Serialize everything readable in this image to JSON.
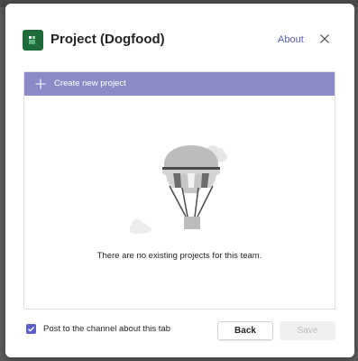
{
  "dialog": {
    "title": "Project (Dogfood)",
    "about_label": "About",
    "app_icon": "project-app-icon",
    "close_icon": "close-icon"
  },
  "panel": {
    "create_label": "Create new project",
    "create_icon": "plus-icon",
    "illustration": "hot-air-balloon-illustration",
    "empty_message": "There are no existing projects for this team."
  },
  "footer": {
    "post_label": "Post to the channel about this tab",
    "post_checked": true,
    "back_label": "Back",
    "save_label": "Save"
  },
  "colors": {
    "accent": "#5b5fc7",
    "create_bar": "#8b8cc7",
    "app_icon_bg": "#1e6b3c"
  }
}
